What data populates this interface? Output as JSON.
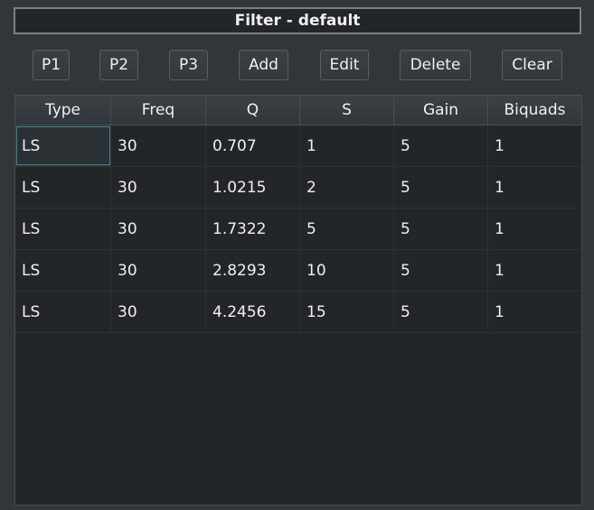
{
  "title": "Filter - default",
  "toolbar": {
    "buttons": [
      {
        "id": "p1",
        "label": "P1"
      },
      {
        "id": "p2",
        "label": "P2"
      },
      {
        "id": "p3",
        "label": "P3"
      },
      {
        "id": "add",
        "label": "Add"
      },
      {
        "id": "edit",
        "label": "Edit"
      },
      {
        "id": "delete",
        "label": "Delete"
      },
      {
        "id": "clear",
        "label": "Clear"
      }
    ]
  },
  "table": {
    "headers": [
      "Type",
      "Freq",
      "Q",
      "S",
      "Gain",
      "Biquads"
    ],
    "rows": [
      [
        "LS",
        "30",
        "0.707",
        "1",
        "5",
        "1"
      ],
      [
        "LS",
        "30",
        "1.0215",
        "2",
        "5",
        "1"
      ],
      [
        "LS",
        "30",
        "1.7322",
        "5",
        "5",
        "1"
      ],
      [
        "LS",
        "30",
        "2.8293",
        "10",
        "5",
        "1"
      ],
      [
        "LS",
        "30",
        "4.2456",
        "15",
        "5",
        "1"
      ]
    ]
  },
  "colors": {
    "background": "#31363b",
    "table_background": "#232629",
    "text": "#eff0f1",
    "focus_outline": "#4e7f91"
  }
}
